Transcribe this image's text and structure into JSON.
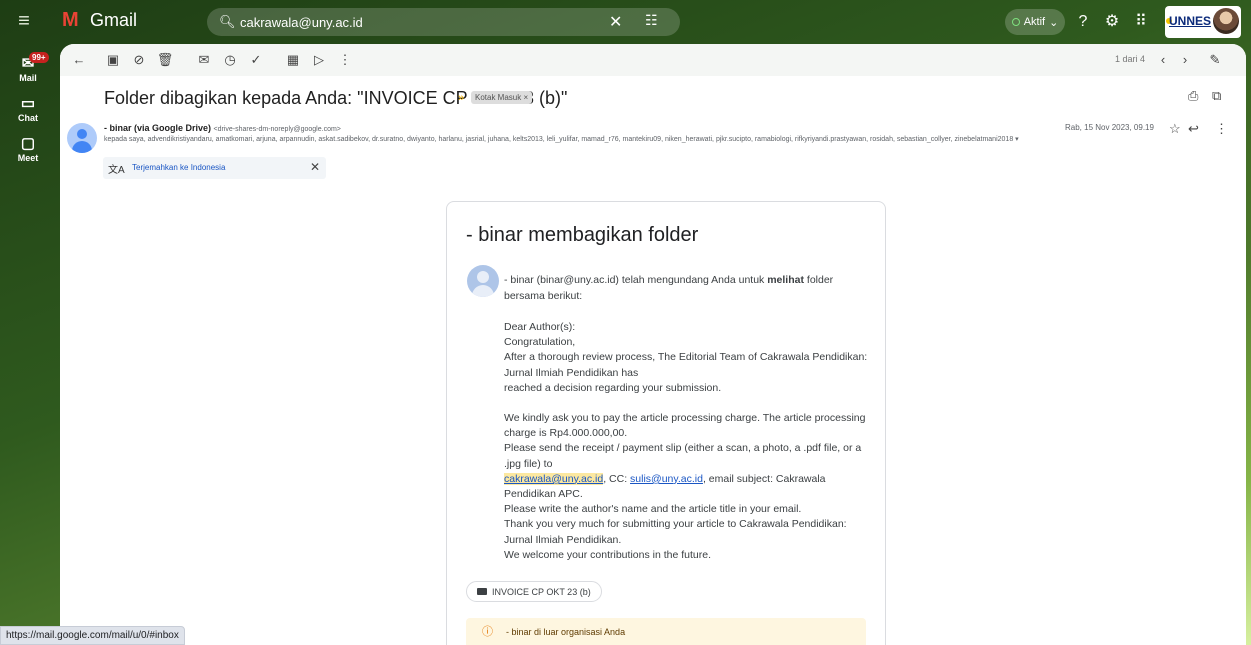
{
  "app": {
    "name": "Gmail"
  },
  "search": {
    "query": "cakrawala@uny.ac.id"
  },
  "status": {
    "label": "Aktif"
  },
  "org": {
    "label": "UNNES"
  },
  "rail": {
    "mail": "Mail",
    "chat": "Chat",
    "meet": "Meet",
    "badge": "99+"
  },
  "toolbar": {
    "pager": "1 dari 4"
  },
  "email": {
    "subject": "Folder dibagikan kepada Anda: \"INVOICE CP OKT 23 (b)\"",
    "label": "Kotak Masuk ×",
    "sender_name": "- binar (via Google Drive)",
    "sender_email": "<drive-shares-dm-noreply@google.com>",
    "recipients": "kepada saya, advendikristiyandaru, amatkomari, arjuna, arpannudin, askat.sadibekov, dr.suratno, dwiyanto, harlanu, jasrial, juhana, kelts2013, leli_yulifar, mamad_r76, mantekiru09, niken_herawati, pjkr.sucipto, ramabiologi, rifkyriyandi.prastyawan, rosidah, sebastian_collyer, zinebelatmani2018 ▾",
    "date": "Rab, 15 Nov 2023, 09.19",
    "translate": "Terjemahkan ke Indonesia"
  },
  "card": {
    "title": "- binar membagikan folder",
    "invite_pre": "- binar (binar@uny.ac.id) telah mengundang Anda untuk ",
    "invite_bold": "melihat",
    "invite_post": " folder bersama berikut:",
    "l1": "Dear Author(s):",
    "l2": "Congratulation,",
    "l3": "After a thorough review process, The Editorial Team of Cakrawala Pendidikan: Jurnal Ilmiah Pendidikan has",
    "l4": "reached a decision regarding your submission.",
    "l5": "We kindly ask you to pay the article processing charge. The article processing charge is Rp4.000.000,00.",
    "l6": "Please send the receipt / payment slip (either a scan, a photo, a .pdf file, or a .jpg file) to",
    "email1": "cakrawala@uny.ac.id",
    "cc": ", CC: ",
    "email2": "sulis@uny.ac.id",
    "l7": ", email subject: Cakrawala Pendidikan APC.",
    "l8": "Please write the author's name and the article title in your email.",
    "l9": "Thank you very much for submitting your article to Cakrawala Pendidikan: Jurnal Ilmiah Pendidikan.",
    "l10": "We welcome your contributions in the future.",
    "folder": "INVOICE CP OKT 23 (b)",
    "warning": "- binar di luar organisasi Anda"
  },
  "statusbar": {
    "url": "https://mail.google.com/mail/u/0/#inbox"
  }
}
